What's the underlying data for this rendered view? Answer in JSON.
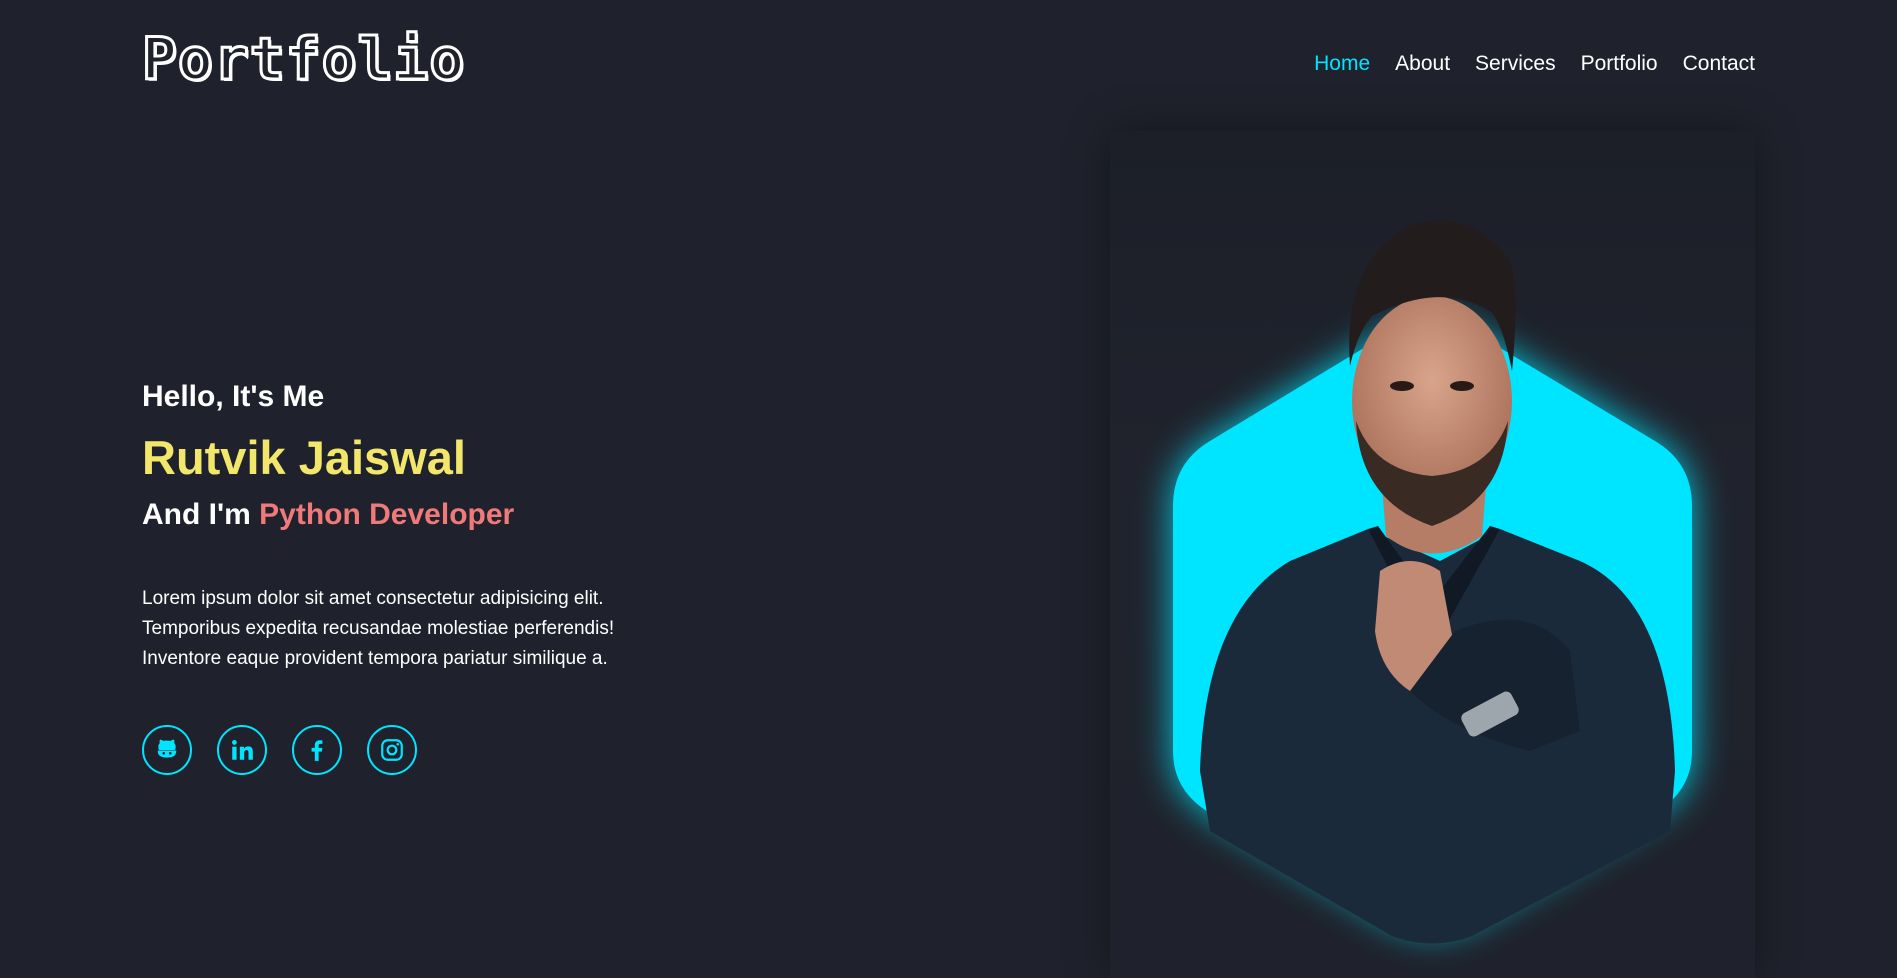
{
  "header": {
    "logo": "Portfolio",
    "nav": [
      {
        "label": "Home",
        "active": true
      },
      {
        "label": "About",
        "active": false
      },
      {
        "label": "Services",
        "active": false
      },
      {
        "label": "Portfolio",
        "active": false
      },
      {
        "label": "Contact",
        "active": false
      }
    ]
  },
  "hero": {
    "greeting": "Hello, It's Me",
    "name": "Rutvik Jaiswal",
    "role_prefix": "And I'm",
    "role": "Python Developer",
    "description_lines": [
      "Lorem ipsum dolor sit amet consectetur adipisicing elit.",
      "Temporibus expedita recusandae molestiae perferendis!",
      "Inventore eaque provident tempora pariatur similique a."
    ],
    "socials": [
      {
        "icon": "github-icon"
      },
      {
        "icon": "linkedin-icon"
      },
      {
        "icon": "facebook-icon"
      },
      {
        "icon": "instagram-icon"
      }
    ]
  },
  "colors": {
    "background": "#1f222c",
    "accent_cyan": "#00e5ff",
    "name_yellow": "#f2e66b",
    "role_red": "#f07a7a"
  }
}
